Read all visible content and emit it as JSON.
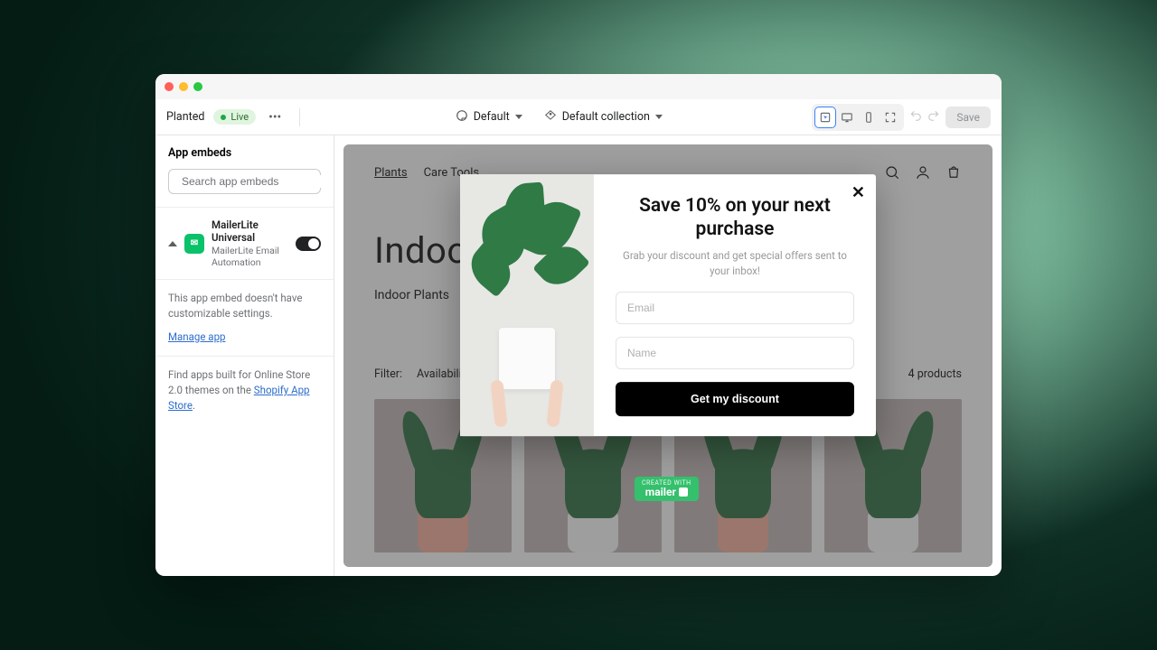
{
  "topbar": {
    "store": "Planted",
    "status": "Live",
    "theme_select_label": "Default",
    "collection_select_label": "Default collection",
    "save_label": "Save"
  },
  "sidebar": {
    "title": "App embeds",
    "search_placeholder": "Search app embeds",
    "app": {
      "name": "MailerLite Universal",
      "subtitle": "MailerLite Email Automation"
    },
    "note": "This app embed doesn't have customizable settings.",
    "manage_link": "Manage app",
    "footer_pre": "Find apps built for Online Store 2.0 themes on the ",
    "footer_link": "Shopify App Store",
    "footer_post": "."
  },
  "storefront": {
    "nav": {
      "plants": "Plants",
      "care": "Care Tools"
    },
    "heading": "Indoor Plants",
    "subheading": "Indoor Plants",
    "filter_label": "Filter:",
    "availability": "Availability",
    "count": "4 products"
  },
  "modal": {
    "title": "Save 10% on your next purchase",
    "subtitle": "Grab your discount and get special offers sent to your inbox!",
    "email_placeholder": "Email",
    "name_placeholder": "Name",
    "cta": "Get my discount"
  },
  "badge": {
    "line1": "CREATED WITH",
    "line2": "mailer"
  }
}
